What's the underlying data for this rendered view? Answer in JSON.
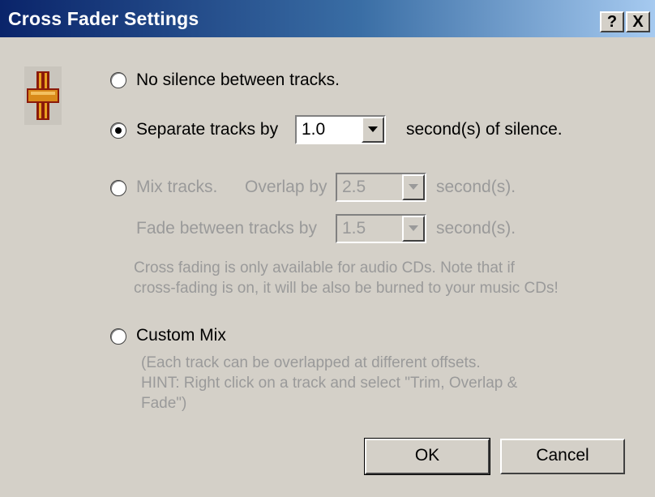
{
  "window": {
    "title": "Cross Fader Settings",
    "help_label": "?",
    "close_label": "X"
  },
  "options": {
    "no_silence": {
      "label": "No silence between tracks.",
      "selected": false
    },
    "separate": {
      "label": "Separate tracks by",
      "value": "1.0",
      "suffix": "second(s) of silence.",
      "selected": true
    },
    "mix": {
      "label": "Mix tracks.",
      "selected": false,
      "overlap_label": "Overlap by",
      "overlap_value": "2.5",
      "overlap_suffix": "second(s).",
      "fade_label": "Fade between tracks by",
      "fade_value": "1.5",
      "fade_suffix": "second(s).",
      "note_line1": "Cross fading is only available for audio CDs.  Note that if",
      "note_line2": "cross-fading is on, it will be also be burned to your music CDs!"
    },
    "custom": {
      "label": "Custom Mix",
      "selected": false,
      "hint_line1": "(Each track can be overlapped at different offsets.",
      "hint_line2": "HINT: Right click on a track and select \"Trim, Overlap &",
      "hint_line3": "Fade\")"
    }
  },
  "buttons": {
    "ok": "OK",
    "cancel": "Cancel"
  }
}
